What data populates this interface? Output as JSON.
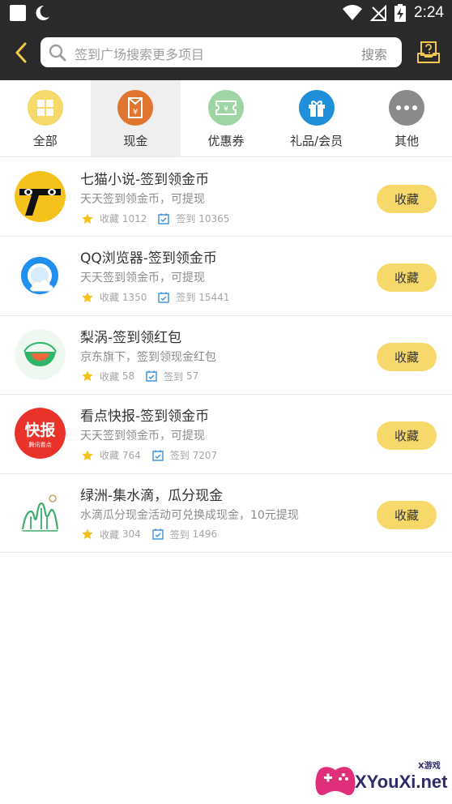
{
  "status_bar": {
    "time": "2:24"
  },
  "header": {
    "search_placeholder": "签到广场搜索更多项目",
    "search_button": "搜索"
  },
  "categories": [
    {
      "label": "全部",
      "icon": "grid-icon",
      "color": "#f7d96b"
    },
    {
      "label": "现金",
      "icon": "yuan-icon",
      "color": "#e0752f"
    },
    {
      "label": "优惠券",
      "icon": "coupon-icon",
      "color": "#9fd4a4"
    },
    {
      "label": "礼品/会员",
      "icon": "gift-icon",
      "color": "#1e8fd8"
    },
    {
      "label": "其他",
      "icon": "more-icon",
      "color": "#8a8a8a"
    }
  ],
  "active_category": "现金",
  "items": [
    {
      "title": "七猫小说-签到领金币",
      "desc": "天天签到领金币，可提现",
      "fav_label": "收藏",
      "fav_count": "1012",
      "sign_label": "签到",
      "sign_count": "10365",
      "button": "收藏"
    },
    {
      "title": "QQ浏览器-签到领金币",
      "desc": "天天签到领金币，可提现",
      "fav_label": "收藏",
      "fav_count": "1350",
      "sign_label": "签到",
      "sign_count": "15441",
      "button": "收藏"
    },
    {
      "title": "梨涡-签到领红包",
      "desc": "京东旗下，签到领现金红包",
      "fav_label": "收藏",
      "fav_count": "58",
      "sign_label": "签到",
      "sign_count": "57",
      "button": "收藏"
    },
    {
      "title": "看点快报-签到领金币",
      "desc": "天天签到领金币，可提现",
      "fav_label": "收藏",
      "fav_count": "764",
      "sign_label": "签到",
      "sign_count": "7207",
      "button": "收藏"
    },
    {
      "title": "绿洲-集水滴，瓜分现金",
      "desc": "水滴瓜分现金活动可兑换成现金，10元提现",
      "fav_label": "收藏",
      "fav_count": "304",
      "sign_label": "签到",
      "sign_count": "1496",
      "button": "收藏"
    }
  ],
  "logos": {
    "kuaibao_text": "快报",
    "kuaibao_sub": "腾讯看点"
  },
  "watermark": {
    "text": "XYouXi.net",
    "sub": "X游戏"
  }
}
